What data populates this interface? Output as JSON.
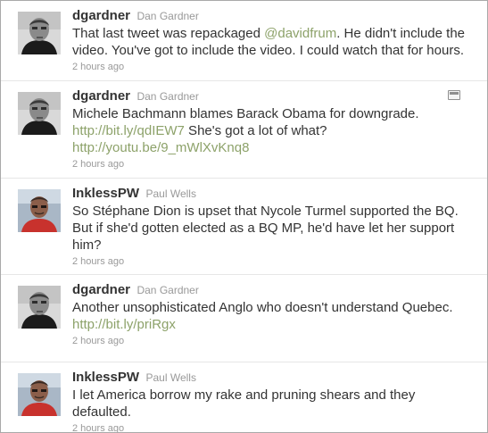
{
  "tweets": [
    {
      "screen_name": "dgardner",
      "full_name": "Dan Gardner",
      "avatar": "dgardner-avatar",
      "segments": [
        {
          "type": "text",
          "value": "That last tweet was repackaged "
        },
        {
          "type": "link",
          "value": "@davidfrum"
        },
        {
          "type": "text",
          "value": ". He didn't include the video. You've got to include the video. I could watch that for hours."
        }
      ],
      "time": "2 hours ago",
      "has_media": false
    },
    {
      "screen_name": "dgardner",
      "full_name": "Dan Gardner",
      "avatar": "dgardner-avatar",
      "segments": [
        {
          "type": "text",
          "value": "Michele Bachmann blames Barack Obama for downgrade. "
        },
        {
          "type": "link",
          "value": "http://bit.ly/qdIEW7"
        },
        {
          "type": "text",
          "value": " She's got a lot of what? "
        },
        {
          "type": "link",
          "value": "http://youtu.be/9_mWlXvKnq8"
        }
      ],
      "time": "2 hours ago",
      "has_media": true
    },
    {
      "screen_name": "InklessPW",
      "full_name": "Paul Wells",
      "avatar": "inklesspw-avatar",
      "segments": [
        {
          "type": "text",
          "value": "So Stéphane Dion is upset that Nycole Turmel supported the BQ. But if she'd gotten elected as a BQ MP, he'd have let her support him?"
        }
      ],
      "time": "2 hours ago",
      "has_media": false
    },
    {
      "screen_name": "dgardner",
      "full_name": "Dan Gardner",
      "avatar": "dgardner-avatar",
      "segments": [
        {
          "type": "text",
          "value": "Another unsophisticated Anglo who doesn't understand Quebec. "
        },
        {
          "type": "link",
          "value": "http://bit.ly/priRgx"
        }
      ],
      "time": "2 hours ago",
      "has_media": false
    },
    {
      "screen_name": "InklessPW",
      "full_name": "Paul Wells",
      "avatar": "inklesspw-avatar",
      "segments": [
        {
          "type": "text",
          "value": "I let America borrow my rake and pruning shears and they defaulted."
        }
      ],
      "time": "2 hours ago",
      "has_media": false
    }
  ],
  "colors": {
    "link": "#8da26a",
    "screen_name": "#333333",
    "meta": "#999999",
    "divider": "#e6e6e6"
  },
  "icons": {
    "media": "media-preview-icon"
  }
}
